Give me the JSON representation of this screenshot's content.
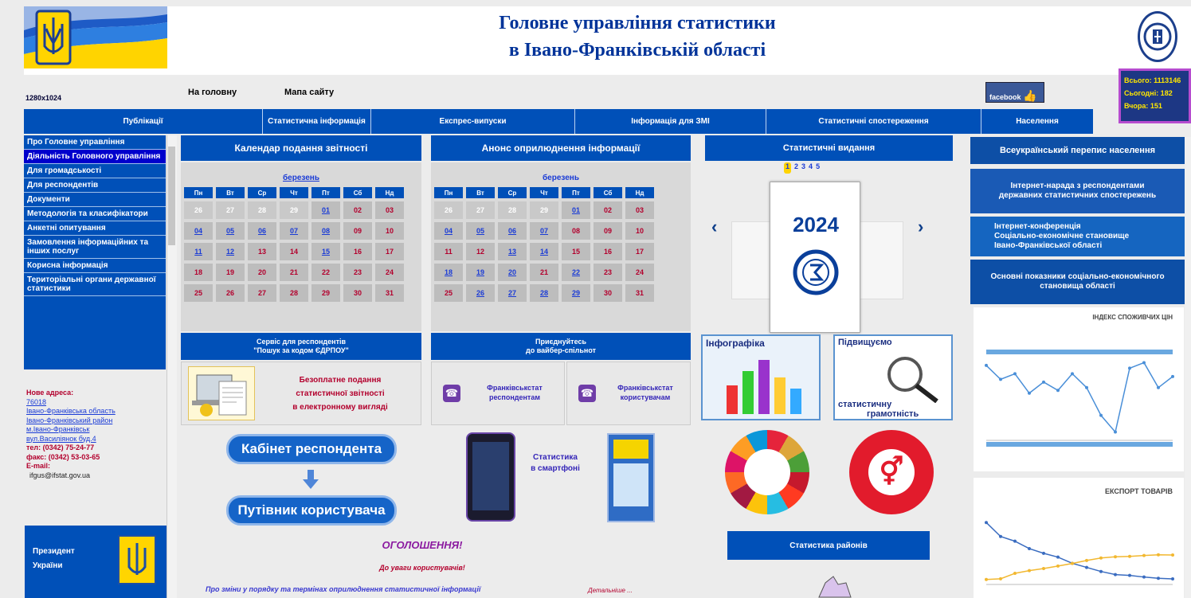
{
  "header": {
    "title_line1": "Головне управління статистики",
    "title_line2": "в Івано-Франківській області"
  },
  "topnav": {
    "resolution": "1280x1024",
    "home": "На головну",
    "sitemap": "Мапа сайту",
    "facebook": "facebook"
  },
  "counter": {
    "line1": "Всього: 1113146",
    "line2": "Сьогодні: 182",
    "line3": "Вчора: 151"
  },
  "mainnav": {
    "items": [
      "Публікації",
      "Статистична інформація",
      "Експрес-випуски",
      "Інформація для ЗМІ",
      "Статистичні спостереження",
      "Населення"
    ]
  },
  "sidebar": {
    "items": [
      "Про Головне управління",
      "Діяльність Головного управління",
      "Для громадськості",
      "Для респондентів",
      "Документи",
      "Методологія та класифікатори",
      "Анкетні опитування",
      "Замовлення інформаційних та інших послуг",
      "Корисна інформація",
      "Територіальні органи державної статистики"
    ]
  },
  "address": {
    "new_address_label": "Нове адреса:",
    "line1": "76018",
    "line2": "Івано-Франківська область",
    "line3": "Івано-Франківський район",
    "line4": "м.Івано-Франківськ",
    "line5": "вул.Василіянок буд.4",
    "tel": "тел: (0342) 75-24-77",
    "fax": "факс: (0342) 53-03-65",
    "email_label": "E-mail:",
    "email": "ifgus@ifstat.gov.ua"
  },
  "president": {
    "line1": "Президент",
    "line2": "України"
  },
  "calendar1": {
    "title": "Календар подання звітності",
    "month": "березень",
    "days": [
      "Пн",
      "Вт",
      "Ср",
      "Чт",
      "Пт",
      "Сб",
      "Нд"
    ],
    "rows": [
      [
        "26",
        "27",
        "28",
        "29",
        "01",
        "02",
        "03"
      ],
      [
        "04",
        "05",
        "06",
        "07",
        "08",
        "09",
        "10"
      ],
      [
        "11",
        "12",
        "13",
        "14",
        "15",
        "16",
        "17"
      ],
      [
        "18",
        "19",
        "20",
        "21",
        "22",
        "23",
        "24"
      ],
      [
        "25",
        "26",
        "27",
        "28",
        "29",
        "30",
        "31"
      ]
    ]
  },
  "calendar2": {
    "title": "Анонс оприлюднення інформації",
    "month": "березень",
    "days": [
      "Пн",
      "Вт",
      "Ср",
      "Чт",
      "Пт",
      "Сб",
      "Нд"
    ],
    "rows": [
      [
        "26",
        "27",
        "28",
        "29",
        "01",
        "02",
        "03"
      ],
      [
        "04",
        "05",
        "06",
        "07",
        "08",
        "09",
        "10"
      ],
      [
        "11",
        "12",
        "13",
        "14",
        "15",
        "16",
        "17"
      ],
      [
        "18",
        "19",
        "20",
        "21",
        "22",
        "23",
        "24"
      ],
      [
        "25",
        "26",
        "27",
        "28",
        "29",
        "30",
        "31"
      ]
    ]
  },
  "publications": {
    "title": "Статистичні видання",
    "pages": [
      "1",
      "2",
      "3",
      "4",
      "5"
    ],
    "cover_year": "2024",
    "prev": "‹",
    "next": "›",
    "infographic_label": "Інфографіка",
    "literacy_line1": "Підвищуємо",
    "literacy_line2": "статистичну",
    "literacy_line3": "грамотність",
    "districts_button": "Статистика районів"
  },
  "service": {
    "title_line1": "Сервіс для респондентів",
    "title_line2": "\"Пошук за кодом ЄДРПОУ\"",
    "free_line1": "Безоплатне подання",
    "free_line2": "статистичної звітності",
    "free_line3": "в електронному вигляді"
  },
  "viber": {
    "title_line1": "Приєднуйтесь",
    "title_line2": "до вайбер-спільнот",
    "resp_line1": "Франківськстат",
    "resp_line2": "респондентам",
    "users_line1": "Франківськстат",
    "users_line2": "користувачам"
  },
  "buttons": {
    "cabinet": "Кабінет респондента",
    "guide": "Путівник користувача",
    "smartphone_line1": "Статистика",
    "smartphone_line2": "в смартфоні"
  },
  "announcements": {
    "title": "ОГОЛОШЕННЯ!",
    "attention": "До уваги користувачів!",
    "text": "Про зміни у порядку та термінах оприлюднення статистичної інформації",
    "more": "Детальніше ..."
  },
  "right": {
    "census": "Всеукраїнський перепис населення",
    "feedback_line1": "Інтернет-нарада з респондентами",
    "feedback_line2": "державних статистичних спостережень",
    "conference_line1": "Інтернет-конференція",
    "conference_line2": "Соціально-економічне становище",
    "conference_line3": "Івано-Франківської області",
    "indicators_line1": "Основні показники соціально-економічного",
    "indicators_line2": "становища області",
    "cpi_title": "ІНДЕКС СПОЖИВЧИХ ЦІН",
    "export_title": "ЕКСПОРТ ТОВАРІВ"
  },
  "chart_data": [
    {
      "type": "line",
      "title": "ІНДЕКС СПОЖИВЧИХ ЦІН",
      "series": [
        {
          "values": [
            101.2,
            100.7,
            100.9,
            100.2,
            100.6,
            100.3,
            100.9,
            100.4,
            99.4,
            98.8,
            101.1,
            101.3,
            100.4,
            100.8
          ]
        }
      ]
    },
    {
      "type": "line",
      "title": "ЕКСПОРТ ТОВАРІВ",
      "series": [
        {
          "values": [
            131.5,
            120.2,
            116.4,
            110.4,
            106.6,
            103.5,
            98.5,
            95.2,
            91.9,
            89.4,
            88.7,
            87.4,
            86.4,
            85.9
          ]
        },
        {
          "values": [
            85.4,
            86.0,
            90.4,
            92.6,
            94.3,
            96.3,
            98.4,
            100.8,
            102.8,
            103.8,
            104.1,
            104.8,
            105.4,
            105.2
          ]
        }
      ]
    }
  ]
}
